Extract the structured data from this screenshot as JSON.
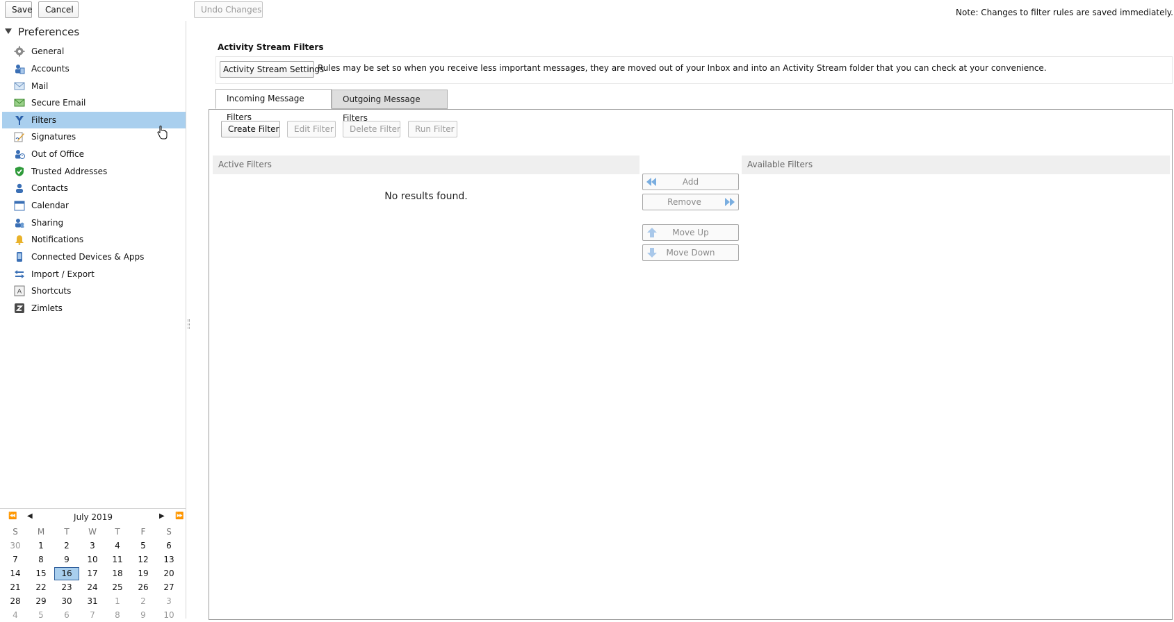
{
  "toolbar": {
    "save_label": "Save",
    "cancel_label": "Cancel",
    "undo_label": "Undo Changes"
  },
  "sidebar": {
    "header": "Preferences",
    "items": [
      {
        "label": "General",
        "icon": "gear-icon"
      },
      {
        "label": "Accounts",
        "icon": "accounts-icon"
      },
      {
        "label": "Mail",
        "icon": "mail-icon"
      },
      {
        "label": "Secure Email",
        "icon": "secure-email-icon"
      },
      {
        "label": "Filters",
        "icon": "filter-icon",
        "selected": true
      },
      {
        "label": "Signatures",
        "icon": "signature-icon"
      },
      {
        "label": "Out of Office",
        "icon": "out-of-office-icon"
      },
      {
        "label": "Trusted Addresses",
        "icon": "shield-check-icon"
      },
      {
        "label": "Contacts",
        "icon": "contact-icon"
      },
      {
        "label": "Calendar",
        "icon": "calendar-icon"
      },
      {
        "label": "Sharing",
        "icon": "sharing-icon"
      },
      {
        "label": "Notifications",
        "icon": "bell-icon"
      },
      {
        "label": "Connected Devices & Apps",
        "icon": "device-icon"
      },
      {
        "label": "Import / Export",
        "icon": "import-export-icon"
      },
      {
        "label": "Shortcuts",
        "icon": "shortcuts-icon"
      },
      {
        "label": "Zimlets",
        "icon": "zimlet-icon"
      }
    ]
  },
  "calendar": {
    "title": "July 2019",
    "nav": {
      "prev_year": "⏪",
      "prev_month": "◀",
      "next_month": "▶",
      "next_year": "⏩"
    },
    "weekdays": [
      "S",
      "M",
      "T",
      "W",
      "T",
      "F",
      "S"
    ],
    "weeks": [
      [
        "30",
        "1",
        "2",
        "3",
        "4",
        "5",
        "6"
      ],
      [
        "7",
        "8",
        "9",
        "10",
        "11",
        "12",
        "13"
      ],
      [
        "14",
        "15",
        "16",
        "17",
        "18",
        "19",
        "20"
      ],
      [
        "21",
        "22",
        "23",
        "24",
        "25",
        "26",
        "27"
      ],
      [
        "28",
        "29",
        "30",
        "31",
        "1",
        "2",
        "3"
      ],
      [
        "4",
        "5",
        "6",
        "7",
        "8",
        "9",
        "10"
      ]
    ],
    "today": "16"
  },
  "main": {
    "note": "Note: Changes to filter rules are saved immediately.",
    "activity_title": "Activity Stream Filters",
    "activity_settings_label": "Activity Stream Settings",
    "activity_description": "Rules may be set so when you receive less important messages, they are moved out of your Inbox and into an Activity Stream folder that you can check at your convenience.",
    "tabs": [
      {
        "label": "Incoming Message Filters",
        "active": true
      },
      {
        "label": "Outgoing Message Filters",
        "active": false
      }
    ],
    "actions": {
      "create": "Create Filter",
      "edit": "Edit Filter",
      "delete": "Delete Filter",
      "run": "Run Filter"
    },
    "active_filters_header": "Active Filters",
    "available_filters_header": "Available Filters",
    "no_results": "No results found.",
    "move": {
      "add": "Add",
      "remove": "Remove",
      "up": "Move Up",
      "down": "Move Down"
    }
  },
  "colors": {
    "selected_bg": "#a9cfee",
    "today_border": "#2f5f9c",
    "header_bg": "#efefef",
    "arrow_blue": "#7aaee0"
  }
}
